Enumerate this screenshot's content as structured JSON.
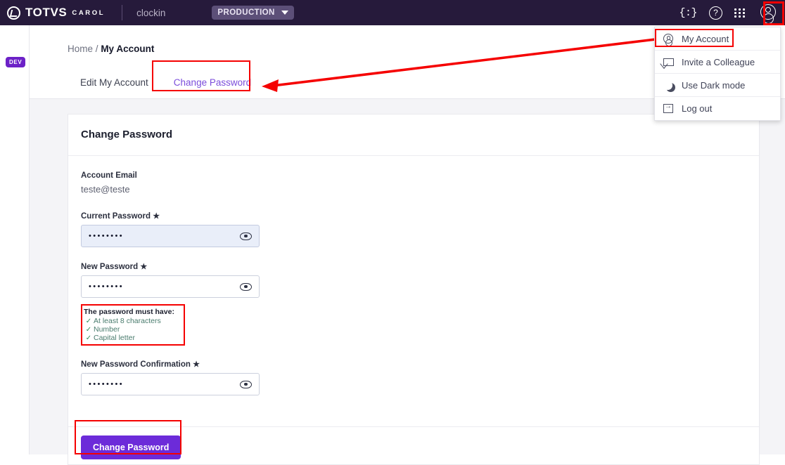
{
  "topbar": {
    "brand": "TOTVS",
    "brand_sub": "CAROL",
    "app_name": "clockin",
    "environment": "PRODUCTION",
    "icons": {
      "braces": "{:}",
      "help": "?",
      "apps": "apps-grid-icon",
      "avatar": "user-avatar-icon"
    }
  },
  "account_menu": {
    "items": [
      {
        "label": "My Account",
        "icon": "person-circle-icon",
        "highlighted": true
      },
      {
        "label": "Invite a Colleague",
        "icon": "envelope-icon",
        "highlighted": false
      },
      {
        "label": "Use Dark mode",
        "icon": "moon-icon",
        "highlighted": false
      },
      {
        "label": "Log out",
        "icon": "logout-icon",
        "highlighted": false
      }
    ]
  },
  "left_rail": {
    "badge": "DEV"
  },
  "breadcrumb": {
    "parent": "Home",
    "separator": "/",
    "current": "My Account"
  },
  "tabs": [
    {
      "label": "Edit My Account",
      "active": false
    },
    {
      "label": "Change Password",
      "active": true
    }
  ],
  "card": {
    "title": "Change Password",
    "account_email_label": "Account Email",
    "account_email_value": "teste@teste",
    "fields": [
      {
        "label": "Current Password",
        "required_mark": "★",
        "value": "••••••••",
        "focused": true
      },
      {
        "label": "New Password",
        "required_mark": "★",
        "value": "••••••••",
        "focused": false
      },
      {
        "label": "New Password Confirmation",
        "required_mark": "★",
        "value": "••••••••",
        "focused": false
      }
    ],
    "password_rules": {
      "title": "The password must have:",
      "check_glyph": "✓",
      "items": [
        "At least 8 characters",
        "Number",
        "Capital letter"
      ]
    },
    "submit_label": "Change Password"
  },
  "colors": {
    "header_bg": "#261A3B",
    "accent_purple": "#6C2BD9",
    "tab_active": "#7B4DDB",
    "annotation_red": "#F50000",
    "rule_green": "#2E8B57",
    "page_bg": "#F4F4F7"
  }
}
